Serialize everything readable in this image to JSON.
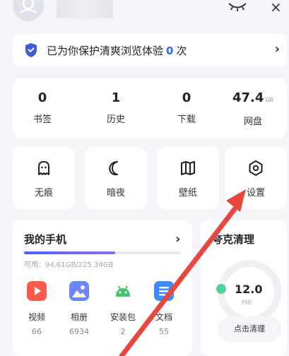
{
  "header": {
    "close_symbol": "×",
    "icons": {
      "avatar": "user-avatar-icon",
      "eye": "eye-closed-icon",
      "close": "close-icon"
    }
  },
  "protection": {
    "text_before": "已为你保护清爽浏览体验",
    "count": "0",
    "text_after": "次",
    "shield_color": "#3f5bd9"
  },
  "stats": [
    {
      "value": "0",
      "unit": "",
      "label": "书签"
    },
    {
      "value": "1",
      "unit": "",
      "label": "历史"
    },
    {
      "value": "0",
      "unit": "",
      "label": "下载"
    },
    {
      "value": "47.4",
      "unit": "GB",
      "label": "网盘"
    }
  ],
  "tools": [
    {
      "label": "无痕",
      "icon": "ghost-icon"
    },
    {
      "label": "暗夜",
      "icon": "moon-icon"
    },
    {
      "label": "壁纸",
      "icon": "book-icon"
    },
    {
      "label": "设置",
      "icon": "settings-hexagon-icon"
    }
  ],
  "phone": {
    "title": "我的手机",
    "storage_text": "可用：94.61GB/225.34GB",
    "storage_used_fraction": 0.58,
    "apps": [
      {
        "label": "视频",
        "count": "66",
        "color": "#ff5a4e",
        "icon": "video-play-icon"
      },
      {
        "label": "相册",
        "count": "6934",
        "color": "#5f7dff",
        "icon": "photo-icon"
      },
      {
        "label": "安装包",
        "count": "2",
        "color": "#4cc36f",
        "icon": "android-icon"
      },
      {
        "label": "文档",
        "count": "55",
        "color": "#3b8dff",
        "icon": "document-icon"
      }
    ]
  },
  "clean": {
    "title": "夸克清理",
    "value": "12.0",
    "unit": "MB",
    "button_label": "点击清理",
    "dot_color": "#4fd39a"
  },
  "accent_colors": {
    "primary": "#2f6bff",
    "annotation_arrow": "#e8473d"
  },
  "chevron": "›"
}
